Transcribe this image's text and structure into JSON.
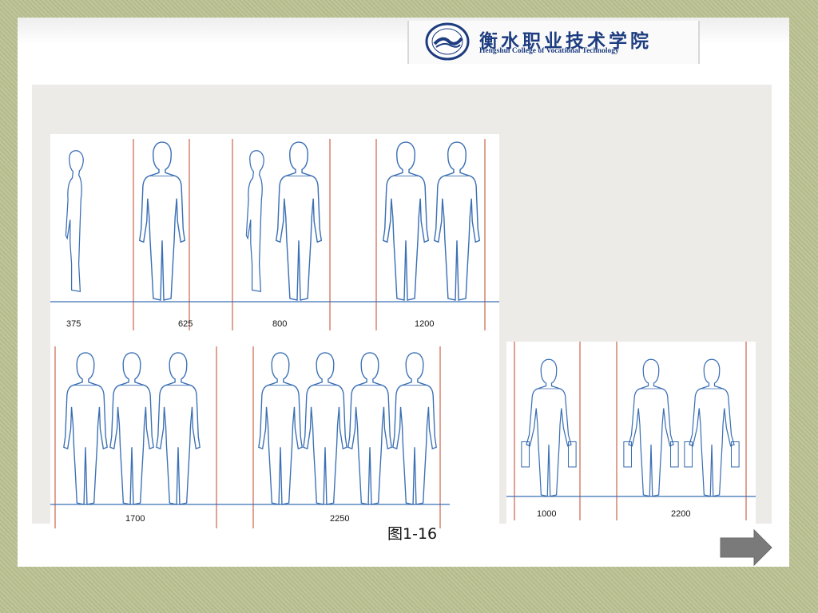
{
  "header": {
    "school_name_cn": "衡水职业技术学院",
    "school_name_en": "Hengshui College of Vocational Technology"
  },
  "figure": {
    "caption": "图1-16",
    "top_row_dimensions": [
      "375",
      "625",
      "800",
      "1200"
    ],
    "bottom_row_dimensions": [
      "1700",
      "2250"
    ],
    "right_panel_dimensions": [
      "1000",
      "2200"
    ]
  },
  "navigation": {
    "next_icon": "right-arrow-icon"
  },
  "colors": {
    "accent_line": "#d98b78",
    "figure_line": "#3a6fb4",
    "school_blue": "#1e3d80"
  }
}
